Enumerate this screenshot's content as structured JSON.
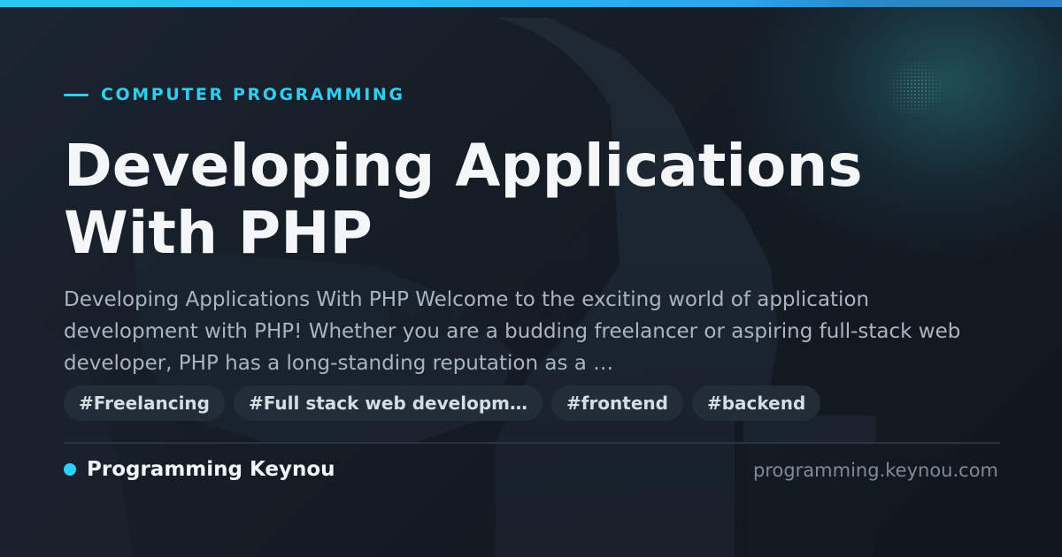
{
  "category": "COMPUTER PROGRAMMING",
  "title": "Developing Applications With PHP",
  "description": "Developing Applications With PHP Welcome to the exciting world of application development with PHP! Whether you are a budding freelancer or aspiring full-stack web developer, PHP has a long-standing reputation as a …",
  "tags": [
    "#Freelancing",
    "#Full stack web developm…",
    "#frontend",
    "#backend"
  ],
  "footer": {
    "site_name": "Programming Keynou",
    "site_url": "programming.keynou.com"
  },
  "colors": {
    "accent": "#2fd0f5",
    "background": "#151b23",
    "title_text": "#f4f6f8",
    "body_text": "#aab4bf"
  },
  "icons": {
    "status": "dot-icon"
  }
}
